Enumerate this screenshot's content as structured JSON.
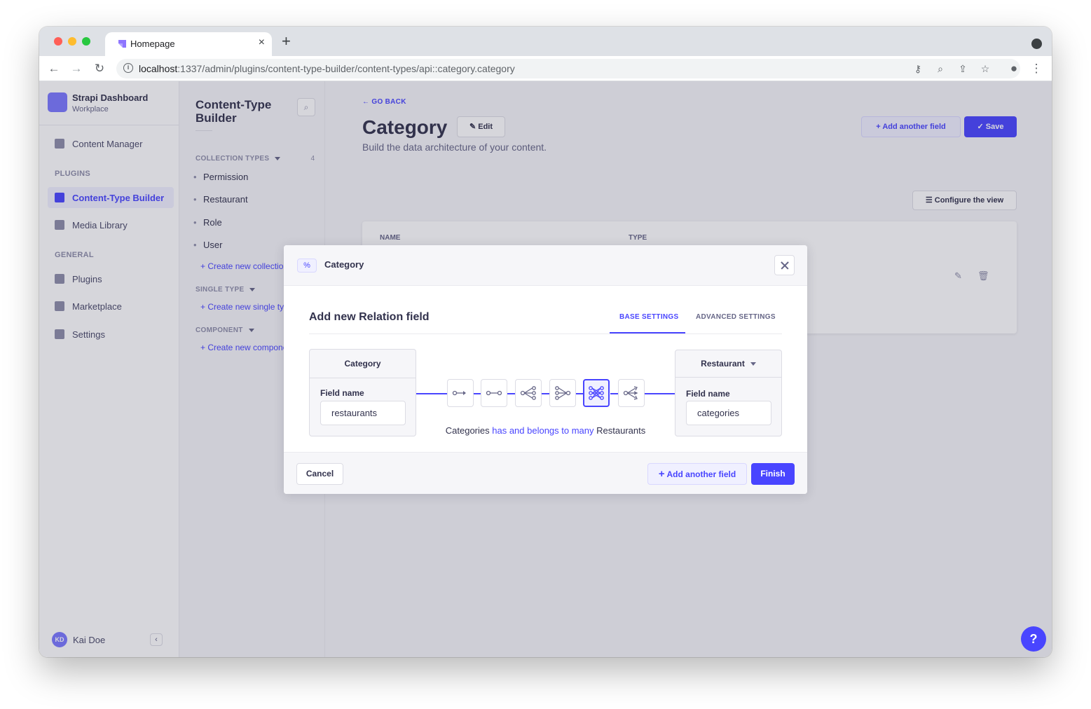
{
  "browser": {
    "tab_title": "Homepage",
    "url_host": "localhost",
    "url_path": ":1337/admin/plugins/content-type-builder/content-types/api::category.category"
  },
  "mainnav": {
    "brand_name": "Strapi Dashboard",
    "brand_sub": "Workplace",
    "content_manager": "Content Manager",
    "plugins_section": "PLUGINS",
    "content_type_builder": "Content-Type Builder",
    "media_library": "Media Library",
    "general_section": "GENERAL",
    "plugins": "Plugins",
    "marketplace": "Marketplace",
    "settings": "Settings",
    "user_initials": "KD",
    "user_name": "Kai Doe"
  },
  "subnav": {
    "title": "Content-Type Builder",
    "collection_types": "COLLECTION TYPES",
    "collection_count": "4",
    "items": [
      "Permission",
      "Restaurant",
      "Role",
      "User"
    ],
    "create_collection": "+ Create new collection type",
    "single_type": "SINGLE TYPE",
    "create_single": "+ Create new single type",
    "component": "COMPONENT",
    "create_component": "+ Create new component"
  },
  "content": {
    "go_back": "GO BACK",
    "title": "Category",
    "edit": "Edit",
    "subtitle": "Build the data architecture of your content.",
    "add_another_field": "Add another field",
    "save": "Save",
    "configure_view": "Configure the view",
    "col_name": "NAME",
    "col_type": "TYPE"
  },
  "modal": {
    "header_title": "Category",
    "body_title": "Add new Relation field",
    "tab_base": "BASE SETTINGS",
    "tab_advanced": "ADVANCED SETTINGS",
    "left_box": {
      "title": "Category",
      "field_label": "Field name",
      "field_value": "restaurants"
    },
    "right_box": {
      "title": "Restaurant",
      "field_label": "Field name",
      "field_value": "categories"
    },
    "relation": {
      "subject": "Categories",
      "verb": "has and belongs to many",
      "object": "Restaurants"
    },
    "relation_icons": [
      "one-way-icon",
      "one-to-one-icon",
      "one-to-many-icon",
      "many-to-one-icon",
      "many-to-many-icon",
      "many-way-icon"
    ],
    "cancel": "Cancel",
    "add_another_field": "Add another field",
    "finish": "Finish"
  },
  "colors": {
    "primary": "#4945ff",
    "primary_light": "#f0f0ff",
    "text": "#32324d"
  }
}
